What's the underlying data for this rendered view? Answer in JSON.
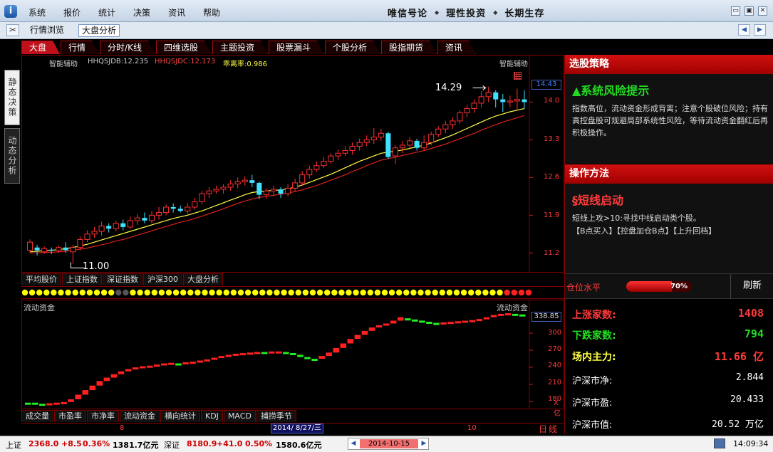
{
  "app": {
    "logo_glyph": "i"
  },
  "menu": [
    {
      "label": "系统"
    },
    {
      "label": "报价"
    },
    {
      "label": "统计"
    },
    {
      "label": "决策"
    },
    {
      "label": "资讯"
    },
    {
      "label": "帮助"
    }
  ],
  "slogan": {
    "w1": "唯信号论",
    "w2": "理性投资",
    "w3": "长期生存",
    "sep": "◆"
  },
  "window_controls": {
    "min": "▭",
    "restore": "▣",
    "close": "✕"
  },
  "toolbar": {
    "hqll": "行情浏览",
    "dpfx": "大盘分析",
    "tool_glyph": "✂",
    "back": "◀",
    "forward": "▶"
  },
  "tabs": [
    {
      "label": "大盘",
      "active": true
    },
    {
      "label": "行情"
    },
    {
      "label": "分时/K线"
    },
    {
      "label": "四维选股"
    },
    {
      "label": "主题投资"
    },
    {
      "label": "股票漏斗"
    },
    {
      "label": "个股分析"
    },
    {
      "label": "股指期货"
    },
    {
      "label": "资讯"
    }
  ],
  "side_tabs": {
    "static": "静态决策",
    "dynamic": "动态分析"
  },
  "main_chart": {
    "indicator": "智能辅助",
    "hhqsjdb": "HHQSJDB:12.235",
    "hhqsjdc": "HHQSJDC:12.173",
    "gl": "乖离率:0.986",
    "indicator_right": "智能辅助",
    "max_label": "14.29",
    "min_label": "11.00",
    "current": "14.43",
    "y_ticks": [
      "14.0",
      "13.3",
      "12.6",
      "11.9",
      "11.2"
    ]
  },
  "chart_data": [
    {
      "type": "candlestick",
      "ylim": [
        10.9,
        14.6
      ],
      "y_ticks": [
        14.0,
        13.3,
        12.6,
        11.9,
        11.2
      ],
      "max_marker": 14.29,
      "min_marker": 11.0,
      "current_value": 14.43,
      "candles": [
        [
          11.25,
          11.4,
          11.2,
          11.45
        ],
        [
          11.3,
          11.25,
          11.15,
          11.35
        ],
        [
          11.22,
          11.28,
          11.18,
          11.32
        ],
        [
          11.26,
          11.24,
          11.18,
          11.3
        ],
        [
          11.24,
          11.3,
          11.2,
          11.34
        ],
        [
          11.3,
          11.25,
          11.2,
          11.4
        ],
        [
          11.22,
          11.3,
          11.0,
          11.35
        ],
        [
          11.3,
          11.45,
          11.25,
          11.5
        ],
        [
          11.45,
          11.55,
          11.4,
          11.62
        ],
        [
          11.55,
          11.6,
          11.48,
          11.68
        ],
        [
          11.6,
          11.7,
          11.52,
          11.78
        ],
        [
          11.7,
          11.65,
          11.58,
          11.75
        ],
        [
          11.65,
          11.75,
          11.6,
          11.8
        ],
        [
          11.75,
          11.68,
          11.62,
          11.82
        ],
        [
          11.68,
          11.8,
          11.65,
          11.88
        ],
        [
          11.8,
          11.85,
          11.72,
          11.92
        ],
        [
          11.85,
          11.8,
          11.75,
          11.95
        ],
        [
          11.8,
          11.9,
          11.75,
          11.98
        ],
        [
          11.9,
          11.95,
          11.82,
          12.05
        ],
        [
          11.95,
          12.05,
          11.9,
          12.1
        ],
        [
          12.05,
          12.02,
          11.95,
          12.12
        ],
        [
          12.02,
          11.98,
          11.95,
          12.08
        ],
        [
          11.98,
          12.05,
          11.92,
          12.12
        ],
        [
          12.05,
          12.15,
          12.0,
          12.22
        ],
        [
          12.15,
          12.3,
          12.1,
          12.35
        ],
        [
          12.3,
          12.35,
          12.22,
          12.42
        ],
        [
          12.35,
          12.38,
          12.3,
          12.45
        ],
        [
          12.38,
          12.42,
          12.3,
          12.48
        ],
        [
          12.42,
          12.48,
          12.35,
          12.55
        ],
        [
          12.48,
          12.52,
          12.4,
          12.6
        ],
        [
          12.52,
          12.55,
          12.45,
          12.62
        ],
        [
          12.55,
          12.5,
          12.42,
          12.65
        ],
        [
          12.5,
          12.28,
          12.2,
          12.52
        ],
        [
          12.28,
          12.35,
          12.2,
          12.4
        ],
        [
          12.35,
          12.38,
          12.25,
          12.45
        ],
        [
          12.38,
          12.3,
          12.22,
          12.42
        ],
        [
          12.3,
          12.4,
          12.25,
          12.48
        ],
        [
          12.4,
          12.5,
          12.35,
          12.58
        ],
        [
          12.5,
          12.65,
          12.45,
          12.72
        ],
        [
          12.65,
          12.75,
          12.58,
          12.82
        ],
        [
          12.75,
          12.82,
          12.7,
          12.9
        ],
        [
          12.82,
          12.9,
          12.78,
          12.98
        ],
        [
          12.9,
          13.0,
          12.85,
          13.05
        ],
        [
          13.0,
          13.05,
          12.92,
          13.12
        ],
        [
          13.05,
          13.1,
          13.0,
          13.18
        ],
        [
          13.1,
          13.18,
          13.02,
          13.25
        ],
        [
          13.18,
          13.25,
          13.1,
          13.32
        ],
        [
          13.25,
          13.3,
          13.18,
          13.38
        ],
        [
          13.3,
          13.35,
          13.22,
          13.52
        ],
        [
          13.35,
          13.42,
          13.28,
          13.5
        ],
        [
          13.42,
          12.98,
          12.95,
          13.45
        ],
        [
          13.0,
          13.15,
          12.85,
          13.2
        ],
        [
          13.15,
          13.2,
          13.05,
          13.28
        ],
        [
          13.2,
          13.28,
          13.12,
          13.35
        ],
        [
          13.28,
          13.15,
          13.1,
          13.32
        ],
        [
          13.15,
          13.25,
          13.1,
          13.38
        ],
        [
          13.25,
          13.4,
          13.2,
          13.45
        ],
        [
          13.4,
          13.5,
          13.35,
          13.55
        ],
        [
          13.5,
          13.58,
          13.42,
          13.65
        ],
        [
          13.58,
          13.65,
          13.5,
          13.72
        ],
        [
          13.65,
          13.8,
          13.6,
          13.85
        ],
        [
          13.8,
          13.88,
          13.72,
          13.95
        ],
        [
          13.88,
          13.98,
          13.8,
          14.05
        ],
        [
          13.98,
          14.1,
          13.9,
          14.2
        ],
        [
          14.1,
          14.18,
          14.0,
          14.29
        ],
        [
          14.18,
          14.05,
          13.9,
          14.22
        ],
        [
          14.05,
          14.0,
          13.82,
          14.15
        ],
        [
          14.0,
          14.02,
          13.9,
          14.12
        ],
        [
          14.02,
          14.05,
          13.85,
          14.25
        ],
        [
          14.05,
          14.0,
          13.88,
          14.22
        ]
      ],
      "series": [
        {
          "color": "#ffff44",
          "values": [
            11.22,
            11.23,
            11.24,
            11.25,
            11.26,
            11.28,
            11.3,
            11.33,
            11.36,
            11.4,
            11.44,
            11.48,
            11.52,
            11.56,
            11.6,
            11.64,
            11.68,
            11.72,
            11.76,
            11.8,
            11.84,
            11.87,
            11.9,
            11.94,
            11.98,
            12.03,
            12.08,
            12.13,
            12.18,
            12.23,
            12.28,
            12.32,
            12.34,
            12.35,
            12.36,
            12.37,
            12.39,
            12.42,
            12.46,
            12.51,
            12.56,
            12.61,
            12.66,
            12.72,
            12.78,
            12.84,
            12.9,
            12.95,
            13.0,
            13.05,
            13.07,
            13.09,
            13.11,
            13.14,
            13.17,
            13.2,
            13.24,
            13.29,
            13.34,
            13.39,
            13.45,
            13.51,
            13.57,
            13.63,
            13.69,
            13.74,
            13.78,
            13.82,
            13.85,
            13.88
          ]
        },
        {
          "color": "#dd2020",
          "values": [
            11.2,
            11.2,
            11.21,
            11.21,
            11.22,
            11.23,
            11.25,
            11.27,
            11.29,
            11.32,
            11.35,
            11.38,
            11.42,
            11.45,
            11.49,
            11.53,
            11.57,
            11.61,
            11.65,
            11.69,
            11.73,
            11.77,
            11.8,
            11.84,
            11.88,
            11.93,
            11.97,
            12.02,
            12.07,
            12.12,
            12.16,
            12.2,
            12.23,
            12.25,
            12.27,
            12.29,
            12.31,
            12.34,
            12.37,
            12.41,
            12.45,
            12.5,
            12.55,
            12.6,
            12.65,
            12.71,
            12.76,
            12.82,
            12.87,
            12.92,
            12.95,
            12.98,
            13.01,
            13.04,
            13.07,
            13.1,
            13.14,
            13.18,
            13.22,
            13.27,
            13.32,
            13.37,
            13.42,
            13.48,
            13.53,
            13.58,
            13.63,
            13.67,
            13.71,
            13.75
          ]
        }
      ]
    },
    {
      "type": "step",
      "ylim": [
        170,
        345
      ],
      "y_ticks": [
        300,
        270,
        240,
        210,
        180
      ],
      "current_value": 338.85,
      "values": [
        176,
        176,
        174,
        175,
        176,
        177,
        182,
        190,
        198,
        206,
        214,
        220,
        226,
        231,
        235,
        238,
        240,
        241,
        243,
        245,
        246,
        245,
        247,
        248,
        250,
        252,
        255,
        258,
        260,
        262,
        263,
        264,
        265,
        265,
        266,
        266,
        265,
        262,
        258,
        255,
        253,
        258,
        264,
        272,
        280,
        288,
        295,
        302,
        308,
        312,
        315,
        320,
        326,
        324,
        322,
        320,
        318,
        316,
        317,
        318,
        319,
        320,
        321,
        323,
        326,
        330,
        332,
        333,
        332,
        331
      ],
      "colors": [
        "g",
        "g",
        "g",
        "r",
        "r",
        "r",
        "r",
        "r",
        "r",
        "r",
        "r",
        "r",
        "r",
        "r",
        "r",
        "r",
        "r",
        "r",
        "r",
        "r",
        "r",
        "g",
        "r",
        "r",
        "r",
        "r",
        "r",
        "r",
        "r",
        "r",
        "r",
        "r",
        "r",
        "g",
        "r",
        "r",
        "g",
        "g",
        "g",
        "g",
        "g",
        "r",
        "r",
        "r",
        "r",
        "r",
        "r",
        "r",
        "r",
        "r",
        "r",
        "r",
        "r",
        "g",
        "g",
        "g",
        "g",
        "g",
        "r",
        "r",
        "r",
        "r",
        "r",
        "r",
        "r",
        "r",
        "r",
        "r",
        "g",
        "g"
      ]
    }
  ],
  "sub_tabs_1": [
    {
      "label": "平均股价"
    },
    {
      "label": "上证指数"
    },
    {
      "label": "深证指数"
    },
    {
      "label": "沪深300"
    },
    {
      "label": "大盘分析"
    }
  ],
  "dots": [
    "y",
    "y",
    "y",
    "y",
    "y",
    "y",
    "y",
    "y",
    "y",
    "y",
    "y",
    "y",
    "y",
    "g",
    "g",
    "y",
    "y",
    "y",
    "y",
    "y",
    "y",
    "y",
    "y",
    "y",
    "y",
    "y",
    "y",
    "y",
    "y",
    "y",
    "y",
    "y",
    "y",
    "y",
    "y",
    "y",
    "y",
    "y",
    "y",
    "y",
    "y",
    "y",
    "y",
    "y",
    "y",
    "y",
    "y",
    "y",
    "y",
    "y",
    "y",
    "y",
    "y",
    "y",
    "y",
    "y",
    "y",
    "y",
    "y",
    "y",
    "y",
    "y",
    "y",
    "y",
    "y",
    "y",
    "y",
    "r",
    "r",
    "r",
    "r"
  ],
  "flow_chart": {
    "title": "流动资金",
    "title_right": "流动资金",
    "current": "338.85",
    "y_ticks": [
      "300",
      "270",
      "240",
      "210",
      "180"
    ],
    "unit": "X亿"
  },
  "sub_tabs_2": [
    {
      "label": "成交量"
    },
    {
      "label": "市盈率"
    },
    {
      "label": "市净率"
    },
    {
      "label": "流动资金"
    },
    {
      "label": "横向统计"
    },
    {
      "label": "KDJ"
    },
    {
      "label": "MACD"
    },
    {
      "label": "捕捞季节"
    }
  ],
  "xaxis": {
    "label_1": "8",
    "label_2": "10",
    "cursor_date": "2014/ 8/27/三",
    "period": "日线"
  },
  "right_panel": {
    "strategy_header": "选股策略",
    "strategy_title": "▲系统风险提示",
    "strategy_text": "指数高位，流动资金形成背离；注意个股破位风险；持有高控盘股可规避局部系统性风险，等待流动资金翻红后再积极操作。",
    "method_header": "操作方法",
    "method_title": "§短线启动",
    "method_text_1": "短线上攻>10:寻找中线启动类个股。",
    "method_text_2": "【B点买入】【控盘加仓B点】【上升回档】",
    "position_label": "仓位水平",
    "position_value": "70%",
    "position_level": 0.7,
    "refresh": "刷新",
    "stats": [
      {
        "label": "上涨家数:",
        "value": "1408",
        "color": "#ff3b3b"
      },
      {
        "label": "下跌家数:",
        "value": "794",
        "color": "#22dd22"
      },
      {
        "label": "场内主力:",
        "value": "11.66 亿",
        "color": "#ffff44",
        "value_color": "#ff3b3b"
      },
      {
        "label": "沪深市净:",
        "value": "2.844"
      },
      {
        "label": "沪深市盈:",
        "value": "20.433"
      },
      {
        "label": "沪深市值:",
        "value": "20.52 万亿"
      }
    ]
  },
  "statusbar": {
    "sh_label": "上证",
    "sh_value": "2368.0",
    "sh_change": "+8.5",
    "sh_pct": "0.36%",
    "sh_amount": "1381.7亿元",
    "sz_label": "深证",
    "sz_value": "8180.9",
    "sz_change": "+41.0",
    "sz_pct": "0.50%",
    "sz_amount": "1580.6亿元",
    "date": "2014-10-15",
    "prev": "◀",
    "next": "▶",
    "time": "14:09:34"
  }
}
